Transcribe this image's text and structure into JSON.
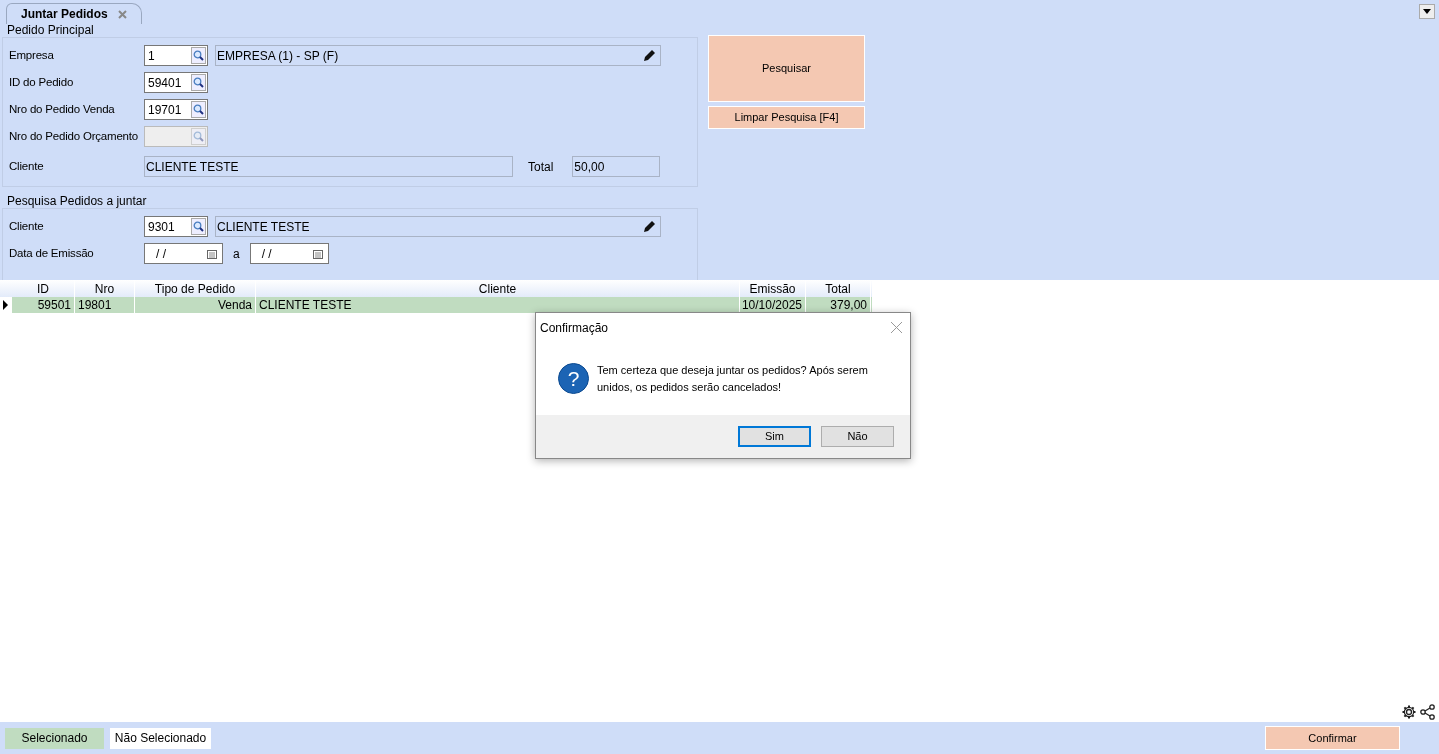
{
  "tab": {
    "label": "Juntar Pedidos",
    "closable": true
  },
  "main_group": {
    "title": "Pedido Principal",
    "fields": [
      {
        "kind": "lookup_desc",
        "label": "Empresa",
        "value": "1",
        "description": "EMPRESA (1) - SP (F)"
      },
      {
        "kind": "lookup",
        "label": "ID do Pedido",
        "value": "59401"
      },
      {
        "kind": "lookup",
        "label": "Nro do Pedido Venda",
        "value": "19701"
      },
      {
        "kind": "lookup",
        "label": "Nro do Pedido Orçamento",
        "disabled": true
      },
      {
        "kind": "text_total",
        "label": "Cliente",
        "value": "CLIENTE TESTE",
        "total_label": "Total",
        "total": "50,00"
      }
    ]
  },
  "search_group": {
    "title": "Pesquisa Pedidos a juntar",
    "fields": [
      {
        "kind": "lookup_desc",
        "label": "Cliente",
        "value": "9301",
        "description": "CLIENTE TESTE"
      },
      {
        "kind": "date_range",
        "label": "Data de Emissão",
        "from": "/ /",
        "separator": "a",
        "to": "/ /"
      }
    ]
  },
  "search_button": "Pesquisar",
  "clear_button": "Limpar Pesquisa [F4]",
  "grid": {
    "columns": [
      "ID",
      "Nro",
      "Tipo de Pedido",
      "Cliente",
      "Emissão",
      "Total"
    ],
    "rows": [
      {
        "selected": true,
        "cells": [
          "59501",
          "19801",
          "Venda",
          "CLIENTE TESTE",
          "10/10/2025",
          "379,00"
        ]
      }
    ]
  },
  "dialog": {
    "title": "Confirmação",
    "icon_glyph": "?",
    "message": "Tem certeza que deseja juntar os pedidos? Após serem unidos, os pedidos serão cancelados!",
    "buttons": [
      {
        "label": "Sim",
        "default": true
      },
      {
        "label": "Não",
        "default": false
      }
    ]
  },
  "legend": [
    {
      "label": "Selecionado",
      "color": "#c0dcc0"
    },
    {
      "label": "Não Selecionado",
      "color": "#ffffff"
    }
  ],
  "confirm_button": "Confirmar"
}
